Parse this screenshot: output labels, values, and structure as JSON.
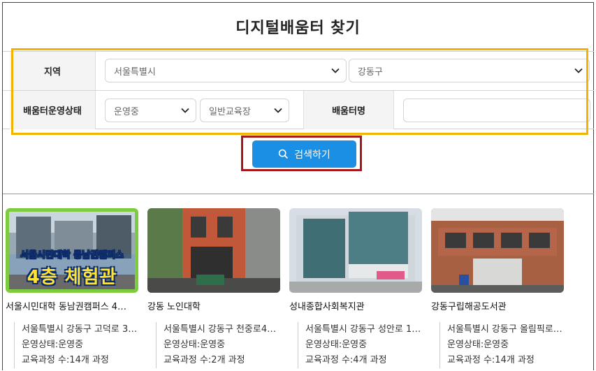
{
  "page_title": "디지털배움터 찾기",
  "filters": {
    "region_label": "지역",
    "region_city": "서울특별시",
    "region_district": "강동구",
    "status_label": "배움터운영상태",
    "status_value": "운영중",
    "type_value": "일반교육장",
    "name_label": "배움터명",
    "name_value": ""
  },
  "search_button": "검색하기",
  "cards": [
    {
      "title": "서울시민대학 동남권캠퍼스 4…",
      "thumb_overlay_line1": "서울시민대학 동남권캠퍼스",
      "thumb_overlay_line2": "4층 체험관",
      "address": "서울특별시 강동구 고덕로 3…",
      "status": "운영상태:운영중",
      "courses": "교육과정 수:14개 과정"
    },
    {
      "title": "강동 노인대학",
      "address": "서울특별시 강동구 천중로4…",
      "status": "운영상태:운영중",
      "courses": "교육과정 수:2개 과정"
    },
    {
      "title": "성내종합사회복지관",
      "address": "서울특별시 강동구 성안로 1…",
      "status": "운영상태:운영중",
      "courses": "교육과정 수:4개 과정"
    },
    {
      "title": "강동구립해공도서관",
      "address": "서울특별시 강동구 올림픽로…",
      "status": "운영상태:운영중",
      "courses": "교육과정 수:14개 과정"
    }
  ],
  "colors": {
    "accent_blue": "#1a8fe3",
    "highlight_yellow": "#f2b400",
    "highlight_red": "#a21a1a"
  },
  "icons": {
    "search": "search-icon",
    "chevron": "chevron-down-icon"
  }
}
